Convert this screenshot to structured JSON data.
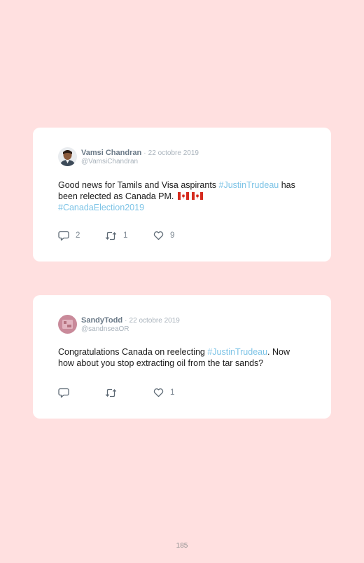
{
  "tweets": [
    {
      "display_name": "Vamsi Chandran",
      "separator": "·",
      "date": "22 octobre 2019",
      "handle": "@VamsiChandran",
      "text_before": "Good news for Tamils and Visa aspirants ",
      "hashtag_1": "#JustinTrudeau",
      "text_middle": " has been relected as Canada PM. ",
      "flag_emoji": "canada-flag-icon",
      "hashtag_2": "#CanadaElection2019",
      "reply_count": "2",
      "retweet_count": "1",
      "like_count": "9"
    },
    {
      "display_name": "SandyTodd",
      "separator": "·",
      "date": "22 octobre 2019",
      "handle": "@sandnseaOR",
      "text_before": "Congratulations Canada on reelecting ",
      "hashtag_1": "#JustinTrudeau",
      "text_after": ". Now how about you stop extracting oil from the tar sands?",
      "reply_count": "",
      "retweet_count": "",
      "like_count": "1"
    }
  ],
  "page_number": "185",
  "colors": {
    "background": "#ffe0e0",
    "card": "#ffffff",
    "hashtag": "#7cc3e6",
    "display_name": "#6b7a88",
    "meta": "#a9b3bc",
    "flag_red": "#d52b1e"
  },
  "icons": {
    "reply": "reply-bubble-icon",
    "retweet": "retweet-icon",
    "like": "heart-icon"
  }
}
